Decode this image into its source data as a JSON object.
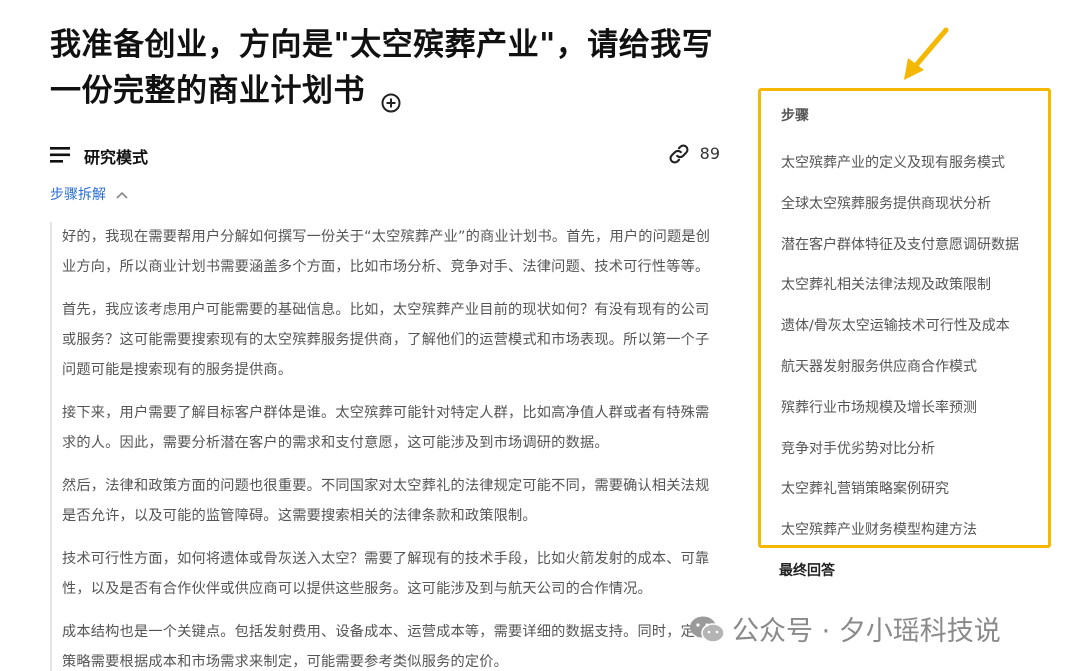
{
  "title": "我准备创业，方向是\"太空殡葬产业\"，请给我写一份完整的商业计划书",
  "mode": {
    "label": "研究模式",
    "link_count": "89"
  },
  "steps_toggle": {
    "label": "步骤拆解"
  },
  "paragraphs": [
    "好的，我现在需要帮用户分解如何撰写一份关于“太空殡葬产业”的商业计划书。首先，用户的问题是创业方向，所以商业计划书需要涵盖多个方面，比如市场分析、竞争对手、法律问题、技术可行性等等。",
    "首先，我应该考虑用户可能需要的基础信息。比如，太空殡葬产业目前的现状如何？有没有现有的公司或服务？这可能需要搜索现有的太空殡葬服务提供商，了解他们的运营模式和市场表现。所以第一个子问题可能是搜索现有的服务提供商。",
    "接下来，用户需要了解目标客户群体是谁。太空殡葬可能针对特定人群，比如高净值人群或者有特殊需求的人。因此，需要分析潜在客户的需求和支付意愿，这可能涉及到市场调研的数据。",
    "然后，法律和政策方面的问题也很重要。不同国家对太空葬礼的法律规定可能不同，需要确认相关法规是否允许，以及可能的监管障碍。这需要搜索相关的法律条款和政策限制。",
    "技术可行性方面，如何将遗体或骨灰送入太空？需要了解现有的技术手段，比如火箭发射的成本、可靠性，以及是否有合作伙伴或供应商可以提供这些服务。这可能涉及到与航天公司的合作情况。",
    "成本结构也是一个关键点。包括发射费用、设备成本、运营成本等，需要详细的数据支持。同时，定价策略需要根据成本和市场需求来制定，可能需要参考类似服务的定价。"
  ],
  "steps_panel": {
    "header": "步骤",
    "items": [
      "太空殡葬产业的定义及现有服务模式",
      "全球太空殡葬服务提供商现状分析",
      "潜在客户群体特征及支付意愿调研数据",
      "太空葬礼相关法律法规及政策限制",
      "遗体/骨灰太空运输技术可行性及成本",
      "航天器发射服务供应商合作模式",
      "殡葬行业市场规模及增长率预测",
      "竞争对手优劣势对比分析",
      "太空葬礼营销策略案例研究",
      "太空殡葬产业财务模型构建方法"
    ]
  },
  "final_answer": {
    "label": "最终回答"
  },
  "watermark": {
    "text": "公众号 · 夕小瑶科技说"
  },
  "colors": {
    "accent_link": "#2b6fd6",
    "highlight_border": "#f5b800",
    "arrow": "#f5b800"
  },
  "icons": [
    "plus-circle-icon",
    "menu-lines-icon",
    "link-icon",
    "chevron-up-icon",
    "wechat-icon",
    "arrow-icon"
  ]
}
